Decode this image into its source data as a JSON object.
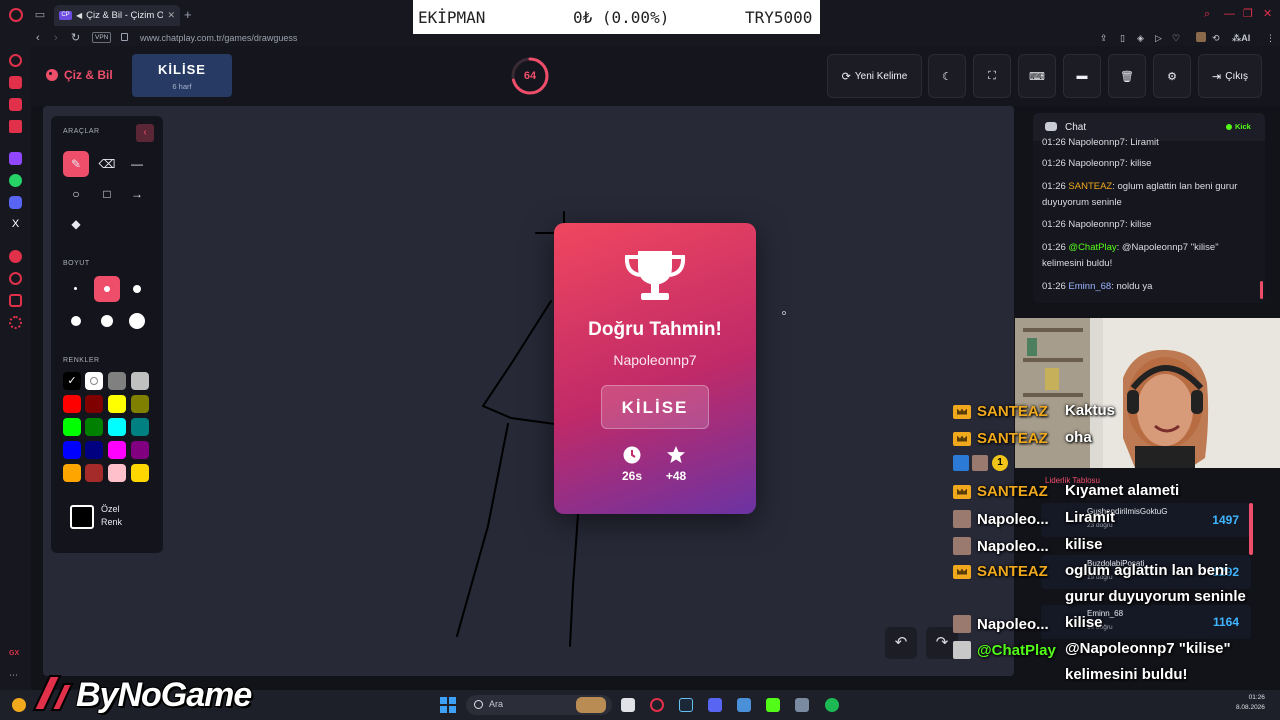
{
  "browser": {
    "tab_title": "Çiz & Bil - Çizim Oyunu",
    "tab_favicon": "CP",
    "new_tab": "+",
    "url": "www.chatplay.com.tr/games/drawguess",
    "vpn": "VPN",
    "extensions": [
      "share-icon",
      "bookmark-icon",
      "shield-icon",
      "play-icon",
      "heart-icon",
      "avatar-icon",
      "translate-icon",
      "ai-icon",
      "more-icon"
    ],
    "ai_label": "AI"
  },
  "equipment_overlay": {
    "label": "EKİPMAN",
    "value": "0₺ (0.00%)",
    "target": "TRY5000"
  },
  "header": {
    "logo_text": "Çiz & Bil",
    "word": "KİLİSE",
    "word_hint": "6 harf",
    "timer": "64",
    "timer_fraction": 0.71,
    "buttons": {
      "new_word": "Yeni Kelime",
      "exit": "Çıkış"
    }
  },
  "tools": {
    "title": "ARAÇLAR",
    "collapse": "‹",
    "size_title": "BOYUT",
    "colors_title": "RENKLER",
    "custom_line1": "Özel",
    "custom_line2": "Renk",
    "colors": [
      "#000000",
      "#ffffff",
      "#808080",
      "#c0c0c0",
      "#ff0000",
      "#800000",
      "#ffff00",
      "#808000",
      "#00ff00",
      "#008000",
      "#00ffff",
      "#008080",
      "#0000ff",
      "#000080",
      "#ff00ff",
      "#800080",
      "#ffa500",
      "#a52a2a",
      "#ffc0cb",
      "#ffd700"
    ],
    "selected_color_index": 0,
    "selected_size_index": 1,
    "selected_tool": "brush"
  },
  "modal": {
    "title": "Doğru Tahmin!",
    "user": "Napoleonnp7",
    "word": "KİLİSE",
    "time": "26s",
    "points": "+48"
  },
  "chat": {
    "title": "Chat",
    "platform": "Kick",
    "messages": [
      {
        "time": "01:26",
        "user": "Napoleonnp7",
        "text": "Liramit",
        "color": "#dcdde4"
      },
      {
        "time": "01:26",
        "user": "Napoleonnp7",
        "text": "kilise",
        "color": "#dcdde4"
      },
      {
        "time": "01:26",
        "user": "SANTEAZ",
        "text": "oglum aglattin lan beni gurur duyuyorum seninle",
        "color": "#f0a81c"
      },
      {
        "time": "01:26",
        "user": "Napoleonnp7",
        "text": "kilise",
        "color": "#dcdde4"
      },
      {
        "time": "01:26",
        "user": "@ChatPlay",
        "text": "@Napoleonnp7 \"kilise\" kelimesini buldu!",
        "color": "#53fc18"
      },
      {
        "time": "01:26",
        "user": "Eminn_68",
        "text": "noldu ya",
        "color": "#9bb3ff"
      }
    ]
  },
  "stream_overlay": {
    "rows": [
      {
        "name": "SANTEAZ",
        "msg": "Kaktus",
        "color": "#f0a81c"
      },
      {
        "name": "SANTEAZ",
        "msg": "oha",
        "color": "#f0a81c"
      },
      {
        "name": "SANTEAZ",
        "msg": "Kıyamet alameti",
        "color": "#f0a81c"
      },
      {
        "name": "Napoleo...",
        "msg": "Liramit",
        "color": "#ffffff"
      },
      {
        "name": "Napoleo...",
        "msg": "kilise",
        "color": "#ffffff"
      },
      {
        "name": "SANTEAZ",
        "msg": "oglum aglattin lan beni",
        "color": "#f0a81c"
      },
      {
        "name": "",
        "msg": "gurur duyuyorum seninle",
        "color": "#ffffff"
      },
      {
        "name": "Napoleo...",
        "msg": "kilise",
        "color": "#ffffff"
      },
      {
        "name": "@ChatPlay",
        "msg": "@Napoleonnp7 \"kilise\"",
        "color": "#53fc18"
      },
      {
        "name": "",
        "msg": "kelimesini buldu!",
        "color": "#ffffff"
      },
      {
        "name": "Emin...",
        "msg": "noldu ya",
        "color": "#9bb3ff"
      }
    ],
    "badge_number": "1",
    "leaderboard_title": "Liderlik Tablosu",
    "leaderboard": [
      {
        "name": "GushendirilmisGoktuG",
        "sub": "23 doğru",
        "score": "1497"
      },
      {
        "name": "BuzdolabiPosati",
        "sub": "19 doğru",
        "score": "1292"
      },
      {
        "name": "Eminn_68",
        "sub": "19 doğru",
        "score": "1164"
      }
    ]
  },
  "taskbar": {
    "search_placeholder": "Ara",
    "time": "01:26",
    "date": "8.08.2026",
    "brand": "ByNoGame"
  }
}
